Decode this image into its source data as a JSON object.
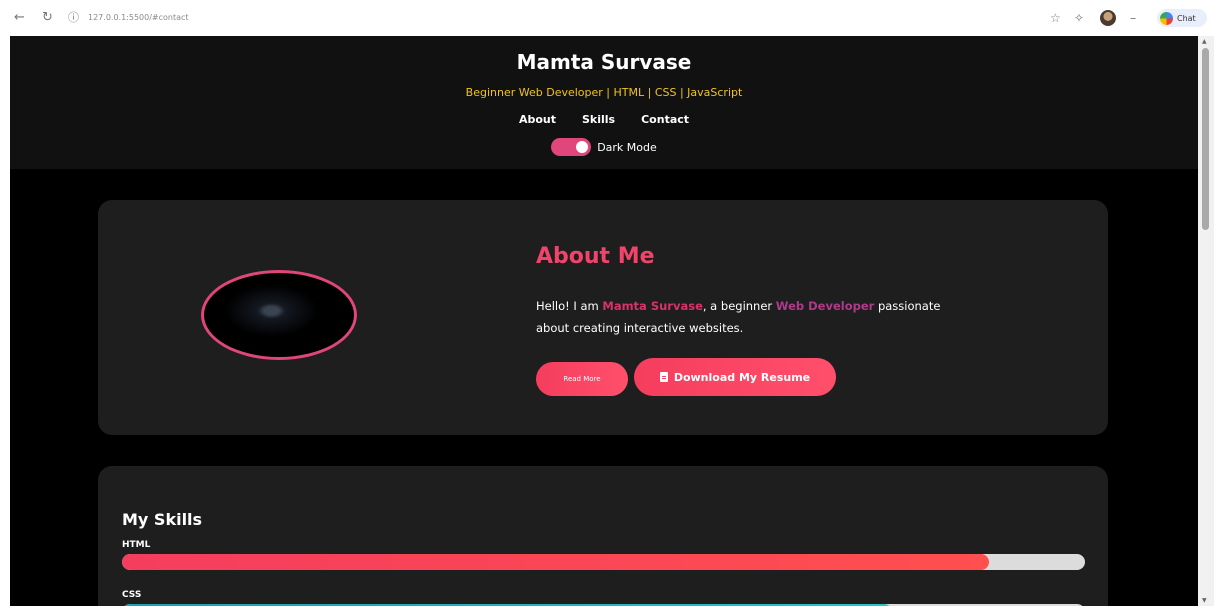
{
  "browser": {
    "url": "127.0.0.1:5500/#contact",
    "chat_label": "Chat",
    "icons": [
      "back-arrow-icon",
      "reload-icon",
      "info-icon",
      "star-icon",
      "extensions-icon",
      "minimize-icon"
    ]
  },
  "header": {
    "title": "Mamta Survase",
    "subtitle": "Beginner Web Developer | HTML | CSS | JavaScript",
    "nav": [
      "About",
      "Skills",
      "Contact"
    ],
    "toggle_label": "Dark Mode",
    "toggle_on": true
  },
  "about": {
    "title": "About Me",
    "text_prefix": "Hello! I am ",
    "name": "Mamta Survase",
    "text_mid": ", a beginner ",
    "role": "Web Developer",
    "text_suffix": " passionate about creating interactive websites.",
    "read_more_label": "Read More",
    "resume_label": "Download My Resume"
  },
  "skills": {
    "title": "My Skills",
    "items": [
      {
        "label": "HTML",
        "level": 0.9
      },
      {
        "label": "CSS",
        "level": 0.8
      }
    ]
  },
  "colors": {
    "accent": "#f53d5e",
    "subtitle": "#f0c420",
    "toggle": "#e0457b",
    "card": "#1e1e1e"
  }
}
